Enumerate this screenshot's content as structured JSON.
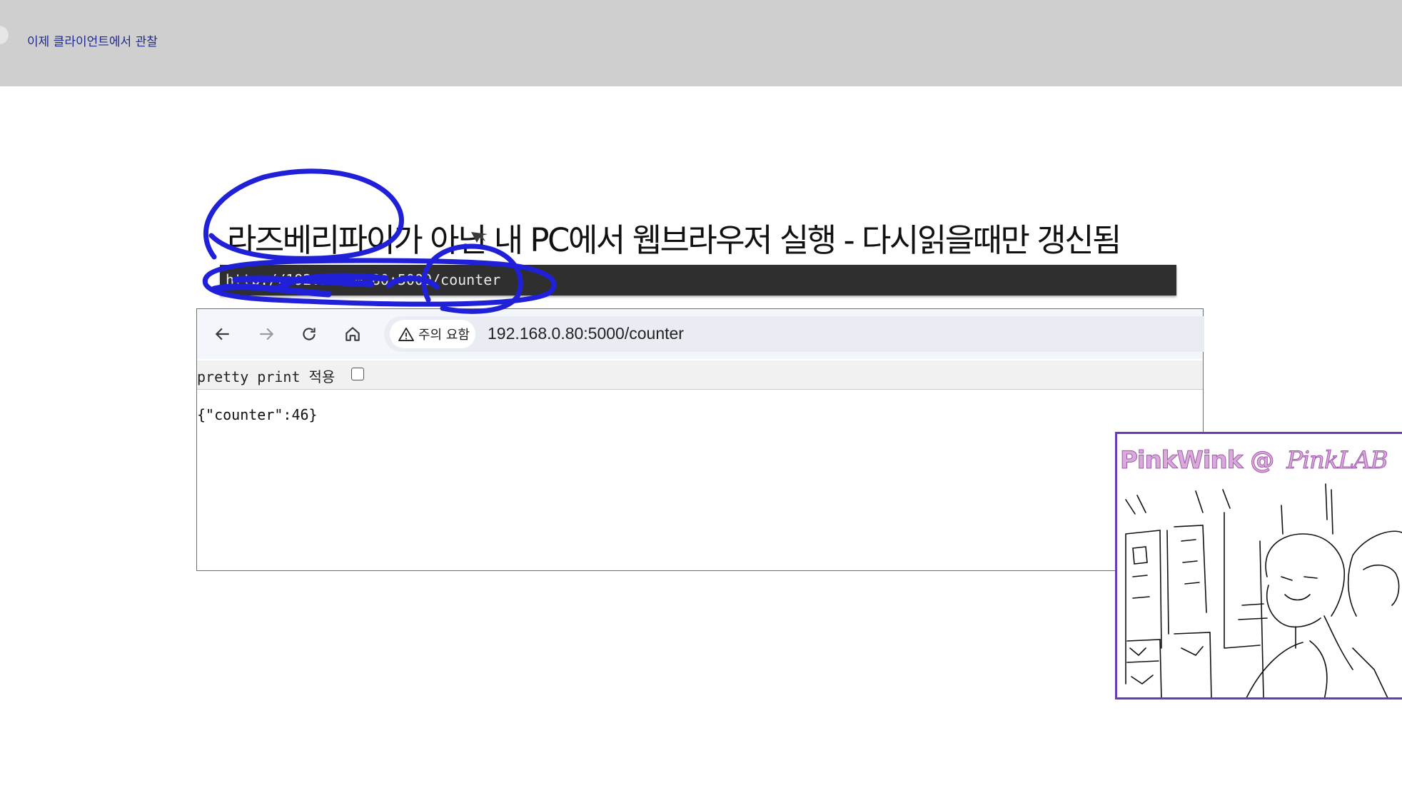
{
  "topbar": {
    "title": "이제 클라이언트에서 관찰"
  },
  "slide": {
    "heading": "라즈베리파이가 아닌 내 PC에서 웹브라우저 실행 - 다시읽을때만 갱신됨",
    "url_strip": "http://192.168.0.80:5000/counter"
  },
  "browser": {
    "icons": [
      "back-icon",
      "forward-icon",
      "reload-icon",
      "home-icon",
      "warning-icon"
    ],
    "security_chip": "주의 요함",
    "address": "192.168.0.80:5000/counter",
    "pretty_print_label": "pretty print 적용",
    "pretty_print_checked": false,
    "json_body": "{\"counter\":46}"
  },
  "webcam": {
    "label": "PinkWink @",
    "label_2": "PinkLAB",
    "border_color": "#6a3cb4"
  },
  "colors": {
    "annotation": "#2020d8",
    "topbar": "#cfcfcf",
    "url_strip": "#2f2f2f"
  }
}
